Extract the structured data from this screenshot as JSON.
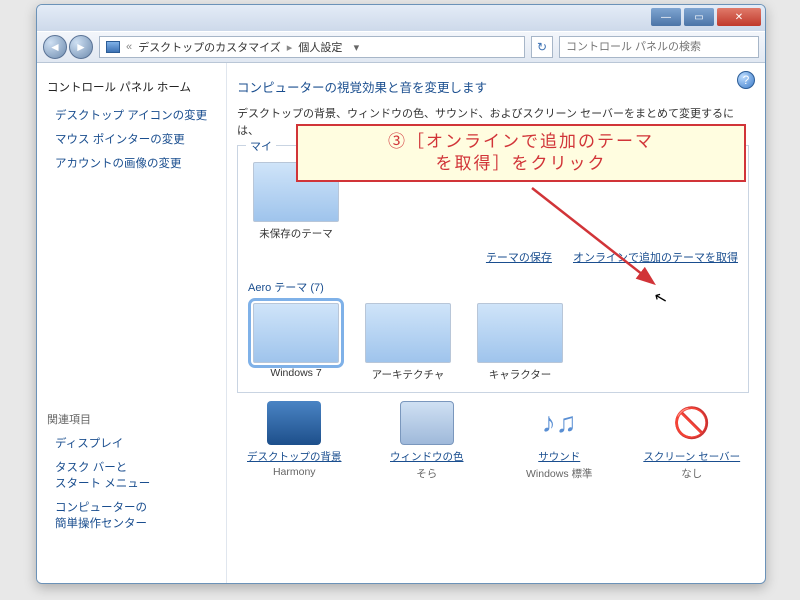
{
  "window": {
    "min_label": "—",
    "max_label": "▭",
    "close_label": "✕"
  },
  "addressbar": {
    "back_glyph": "◄",
    "fwd_glyph": "►",
    "crumb_prefix": "«",
    "crumb1": "デスクトップのカスタマイズ",
    "crumb2": "個人設定",
    "sep": "▸",
    "dropdown_glyph": "▾",
    "refresh_glyph": "↻"
  },
  "search": {
    "placeholder": "コントロール パネルの検索"
  },
  "sidebar": {
    "home": "コントロール パネル ホーム",
    "tasks": [
      "デスクトップ アイコンの変更",
      "マウス ポインターの変更",
      "アカウントの画像の変更"
    ],
    "related_head": "関連項目",
    "related": [
      "ディスプレイ",
      "タスク バーと\nスタート メニュー",
      "コンピューターの\n簡単操作センター"
    ]
  },
  "main": {
    "title": "コンピューターの視覚効果と音を変更します",
    "desc_line1": "デスクトップの背景、ウィンドウの色、サウンド、およびスクリーン セーバーをまとめて変更するに",
    "desc_line2": "は、",
    "group_my_themes": "マイ",
    "unsaved_theme": "未保存のテーマ",
    "link_save": "テーマの保存",
    "link_online": "オンラインで追加のテーマを取得",
    "aero_label": "Aero テーマ (7)",
    "aero_themes": [
      "Windows 7",
      "アーキテクチャ",
      "キャラクター"
    ]
  },
  "bottom": {
    "items": [
      {
        "label": "デスクトップの背景",
        "value": "Harmony"
      },
      {
        "label": "ウィンドウの色",
        "value": "そら"
      },
      {
        "label": "サウンド",
        "value": "Windows 標準"
      },
      {
        "label": "スクリーン セーバー",
        "value": "なし"
      }
    ]
  },
  "callout": {
    "text": "③［オンラインで追加のテーマ\nを取得］をクリック"
  },
  "help_glyph": "?"
}
